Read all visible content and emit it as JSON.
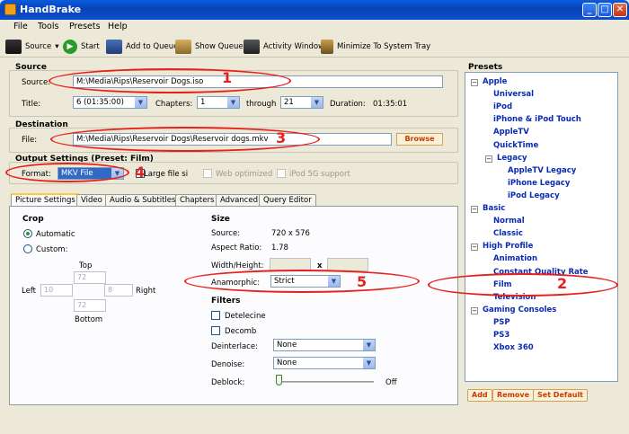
{
  "window": {
    "title": "HandBrake",
    "minimize": "_",
    "maximize": "□",
    "close": "✕"
  },
  "menu": [
    "File",
    "Tools",
    "Presets",
    "Help"
  ],
  "toolbar": {
    "source": "Source",
    "start": "Start",
    "add_to_queue": "Add to Queue",
    "show_queue": "Show Queue",
    "activity_window": "Activity Window",
    "minimize_tray": "Minimize To System Tray"
  },
  "source": {
    "group": "Source",
    "source_label": "Source:",
    "source_value": "M:\\Media\\Rips\\Reservoir Dogs.iso",
    "title_label": "Title:",
    "title_value": "6 (01:35:00)",
    "chapters_label": "Chapters:",
    "chapters_from": "1",
    "through_label": "through",
    "chapters_to": "21",
    "duration_label": "Duration:",
    "duration_value": "01:35:01"
  },
  "destination": {
    "group": "Destination",
    "file_label": "File:",
    "file_value": "M:\\Media\\Rips\\Reservoir Dogs\\Reservoir dogs.mkv",
    "browse": "Browse"
  },
  "output": {
    "group": "Output Settings (Preset: Film)",
    "format_label": "Format:",
    "format_value": "MKV File",
    "large_file": "Large file si",
    "web_optimized": "Web optimized",
    "ipod": "iPod 5G support"
  },
  "tabs": [
    "Picture Settings",
    "Video",
    "Audio & Subtitles",
    "Chapters",
    "Advanced",
    "Query Editor"
  ],
  "crop": {
    "heading": "Crop",
    "automatic": "Automatic",
    "custom": "Custom:",
    "top": "Top",
    "bottom": "Bottom",
    "left": "Left",
    "right": "Right",
    "top_val": "72",
    "left_val": "10",
    "right_val": "8",
    "bottom_val": "72"
  },
  "size": {
    "heading": "Size",
    "source_label": "Source:",
    "source_value": "720 x 576",
    "aspect_label": "Aspect Ratio:",
    "aspect_value": "1.78",
    "wh_label": "Width/Height:",
    "x": "x",
    "anamorphic_label": "Anamorphic:",
    "anamorphic_value": "Strict"
  },
  "filters": {
    "heading": "Filters",
    "detelecine": "Detelecine",
    "decomb": "Decomb",
    "deinterlace_label": "Deinterlace:",
    "deinterlace_value": "None",
    "denoise_label": "Denoise:",
    "denoise_value": "None",
    "deblock_label": "Deblock:",
    "deblock_value": "Off"
  },
  "presets": {
    "heading": "Presets",
    "groups": [
      {
        "name": "Apple",
        "toggle": "−",
        "items": [
          "Universal",
          "iPod",
          "iPhone & iPod Touch",
          "AppleTV",
          "QuickTime"
        ]
      },
      {
        "name": "Legacy",
        "toggle": "−",
        "items": [
          "AppleTV Legacy",
          "iPhone Legacy",
          "iPod Legacy"
        ]
      },
      {
        "name": "Basic",
        "toggle": "−",
        "items": [
          "Normal",
          "Classic"
        ]
      },
      {
        "name": "High Profile",
        "toggle": "−",
        "items": [
          "Animation",
          "Constant Quality Rate",
          "Film",
          "Television"
        ]
      },
      {
        "name": "Gaming Consoles",
        "toggle": "−",
        "items": [
          "PSP",
          "PS3",
          "Xbox 360"
        ]
      }
    ],
    "add": "Add",
    "remove": "Remove",
    "set_default": "Set Default"
  },
  "annotations": [
    "1",
    "2",
    "3",
    "4",
    "5"
  ],
  "colors": {
    "accent": "#e8201c",
    "preset_text": "#0a2ab4",
    "titlebar": "#0a5ce0"
  }
}
